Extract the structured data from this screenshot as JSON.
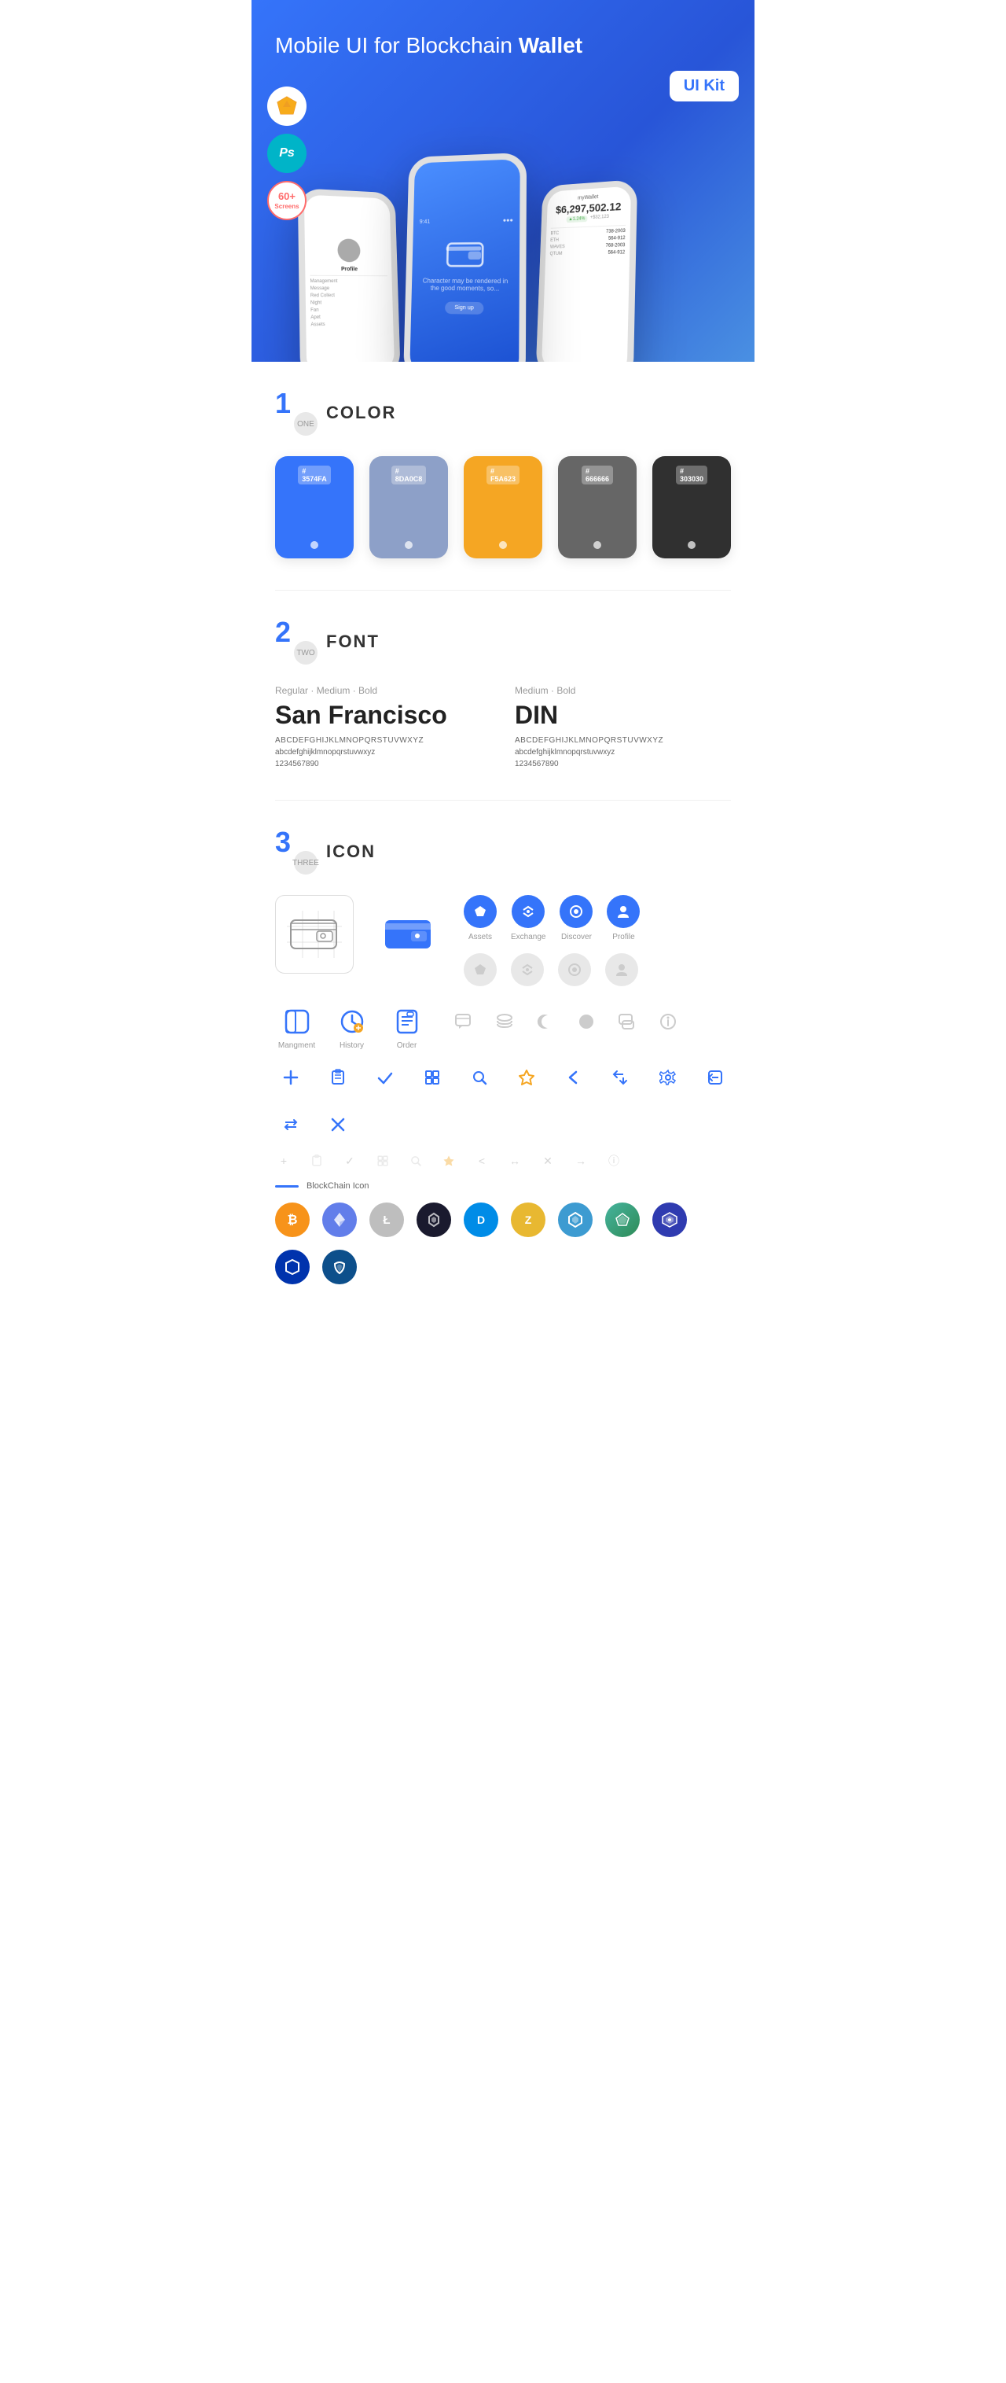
{
  "hero": {
    "title_normal": "Mobile UI for Blockchain ",
    "title_bold": "Wallet",
    "badge": "UI Kit",
    "tools": [
      {
        "name": "Sketch",
        "color": "#fff",
        "text_color": "#F7AB1B"
      },
      {
        "name": "Ps",
        "color": "#00b4c8",
        "text_color": "#fff"
      },
      {
        "name": "60+\nScreens",
        "color": "#fff",
        "text_color": "#FF6B6B"
      }
    ]
  },
  "sections": {
    "color": {
      "number": "1",
      "number_text": "ONE",
      "title": "COLOR",
      "swatches": [
        {
          "hex": "#3574FA",
          "label": "#3574FA",
          "is_dark": false
        },
        {
          "hex": "#8DA0C8",
          "label": "#8DA0C8",
          "is_dark": false
        },
        {
          "hex": "#F5A623",
          "label": "#F5A623",
          "is_dark": false
        },
        {
          "hex": "#666666",
          "label": "#666666",
          "is_dark": false
        },
        {
          "hex": "#303030",
          "label": "#303030",
          "is_dark": false
        }
      ]
    },
    "font": {
      "number": "2",
      "number_text": "TWO",
      "title": "FONT",
      "fonts": [
        {
          "weights": "Regular · Medium · Bold",
          "name": "San Francisco",
          "uppercase": "ABCDEFGHIJKLMNOPQRSTUVWXYZ",
          "lowercase": "abcdefghijklmnopqrstuvwxyz",
          "numbers": "1234567890"
        },
        {
          "weights": "Medium · Bold",
          "name": "DIN",
          "uppercase": "ABCDEFGHIJKLMNOPQRSTUVWXYZ",
          "lowercase": "abcdefghijklmnopqrstuvwxyz",
          "numbers": "1234567890"
        }
      ]
    },
    "icon": {
      "number": "3",
      "number_text": "THREE",
      "title": "ICON",
      "nav_icons": [
        {
          "label": "Assets",
          "active": true
        },
        {
          "label": "Exchange",
          "active": true
        },
        {
          "label": "Discover",
          "active": true
        },
        {
          "label": "Profile",
          "active": true
        }
      ],
      "app_icons": [
        {
          "label": "Mangment"
        },
        {
          "label": "History"
        },
        {
          "label": "Order"
        }
      ],
      "tool_icons": [
        "+",
        "📋",
        "✓",
        "⊞",
        "🔍",
        "☆",
        "<",
        "<>",
        "⚙",
        "⬛",
        "⇄",
        "×"
      ],
      "blockchain_label": "BlockChain Icon",
      "crypto_coins": [
        {
          "symbol": "₿",
          "color": "#F7931A",
          "name": "Bitcoin"
        },
        {
          "symbol": "Ξ",
          "color": "#627EEA",
          "name": "Ethereum"
        },
        {
          "symbol": "Ł",
          "color": "#A6A9AA",
          "name": "Litecoin"
        },
        {
          "symbol": "◆",
          "color": "#1A1A2E",
          "name": "BlackCoin"
        },
        {
          "symbol": "D",
          "color": "#008CE7",
          "name": "Dash"
        },
        {
          "symbol": "Z",
          "color": "#E8B831",
          "name": "Zcash"
        },
        {
          "symbol": "⬡",
          "color": "#3D9BD1",
          "name": "Polygon"
        },
        {
          "symbol": "△",
          "color": "#46B49E",
          "name": "ArkChain"
        },
        {
          "symbol": "◈",
          "color": "#2F3BB0",
          "name": "Cartesi"
        },
        {
          "symbol": "◇",
          "color": "#0033AD",
          "name": "Chainlink"
        },
        {
          "symbol": "~",
          "color": "#0D4F8B",
          "name": "Polymath"
        }
      ]
    }
  }
}
